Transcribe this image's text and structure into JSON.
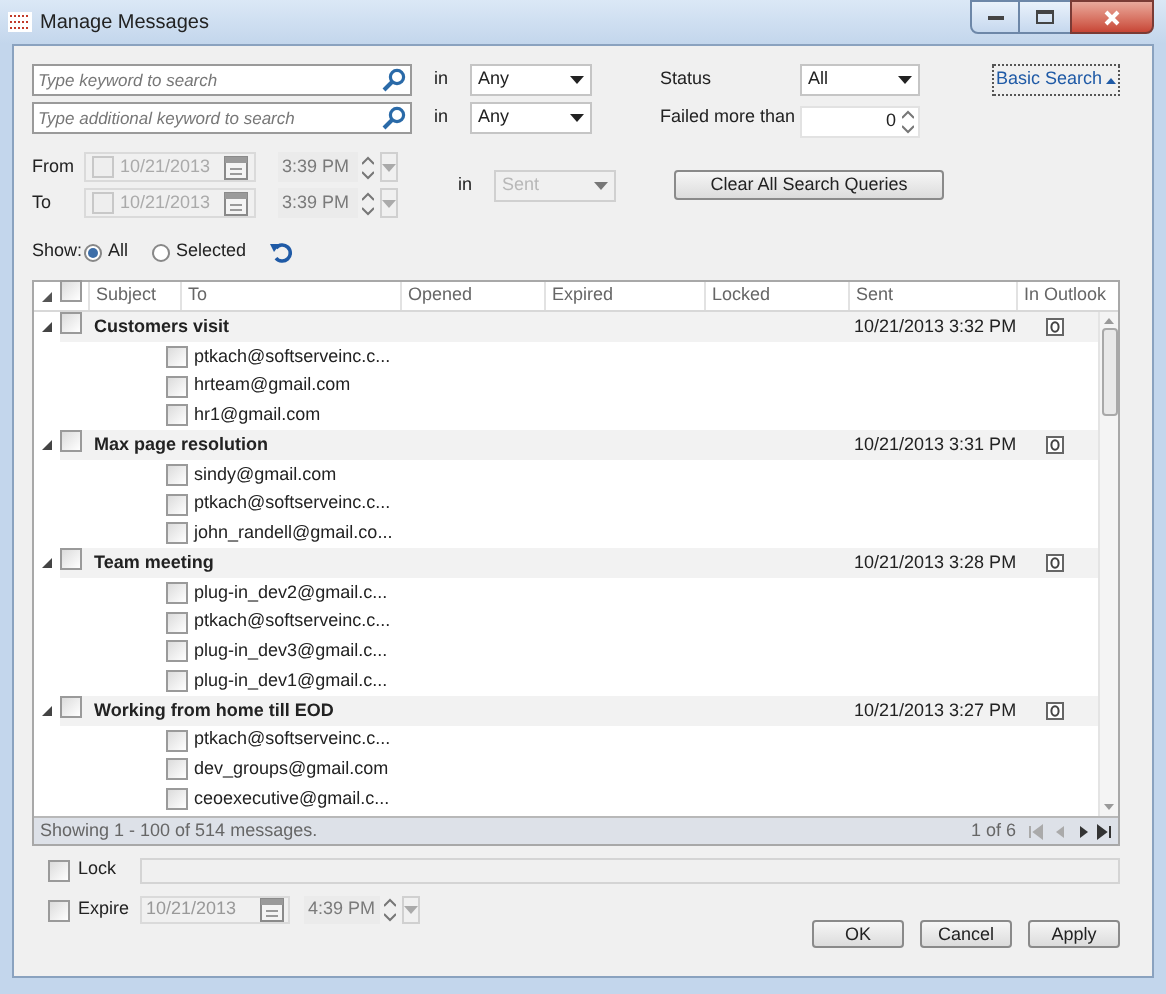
{
  "window": {
    "title": "Manage Messages"
  },
  "search_rows": [
    {
      "placeholder": "Type keyword to search",
      "in_label": "in",
      "scope": "Any"
    },
    {
      "placeholder": "Type additional keyword to search",
      "in_label": "in",
      "scope": "Any"
    }
  ],
  "status_filter": {
    "label": "Status",
    "value": "All"
  },
  "failed_filter": {
    "label": "Failed more than",
    "value": "0"
  },
  "basic_search_link": "Basic Search",
  "date_range": {
    "disabled": true,
    "rows": [
      {
        "label": "From",
        "date": "10/21/2013",
        "time": "3:39 PM"
      },
      {
        "label": "To",
        "date": "10/21/2013",
        "time": "3:39 PM"
      }
    ],
    "in_label": "in",
    "scope": "Sent"
  },
  "clear_button": "Clear All Search Queries",
  "show": {
    "label": "Show:",
    "options": [
      {
        "label": "All",
        "selected": true
      },
      {
        "label": "Selected",
        "selected": false
      }
    ]
  },
  "grid": {
    "select_all_checked": false,
    "columns": [
      "Subject",
      "To",
      "Opened",
      "Expired",
      "Locked",
      "Sent",
      "In Outlook"
    ],
    "groups": [
      {
        "subject": "Customers visit",
        "sent": "10/21/2013 3:32 PM",
        "expanded": true,
        "checked": false,
        "recipients": [
          {
            "to": "ptkach@softserveinc.c...",
            "checked": false
          },
          {
            "to": "hrteam@gmail.com",
            "checked": false
          },
          {
            "to": "hr1@gmail.com",
            "checked": false
          }
        ]
      },
      {
        "subject": "Max page resolution",
        "sent": "10/21/2013 3:31 PM",
        "expanded": true,
        "checked": false,
        "recipients": [
          {
            "to": "sindy@gmail.com",
            "checked": false
          },
          {
            "to": "ptkach@softserveinc.c...",
            "checked": false
          },
          {
            "to": "john_randell@gmail.co...",
            "checked": false
          }
        ]
      },
      {
        "subject": "Team meeting",
        "sent": "10/21/2013 3:28 PM",
        "expanded": true,
        "checked": false,
        "recipients": [
          {
            "to": "plug-in_dev2@gmail.c...",
            "checked": false
          },
          {
            "to": "ptkach@softserveinc.c...",
            "checked": false
          },
          {
            "to": "plug-in_dev3@gmail.c...",
            "checked": false
          },
          {
            "to": "plug-in_dev1@gmail.c...",
            "checked": false
          }
        ]
      },
      {
        "subject": "Working from home till EOD",
        "sent": "10/21/2013 3:27 PM",
        "expanded": true,
        "checked": false,
        "recipients": [
          {
            "to": "ptkach@softserveinc.c...",
            "checked": false
          },
          {
            "to": "dev_groups@gmail.com",
            "checked": false
          },
          {
            "to": "ceoexecutive@gmail.c...",
            "checked": false
          }
        ]
      }
    ],
    "status_text": "Showing 1 - 100 of 514 messages.",
    "pager": "1 of 6"
  },
  "lock": {
    "label": "Lock",
    "checked": false
  },
  "expire": {
    "label": "Expire",
    "checked": false,
    "date": "10/21/2013",
    "time": "4:39 PM"
  },
  "buttons": [
    "OK",
    "Cancel",
    "Apply"
  ]
}
